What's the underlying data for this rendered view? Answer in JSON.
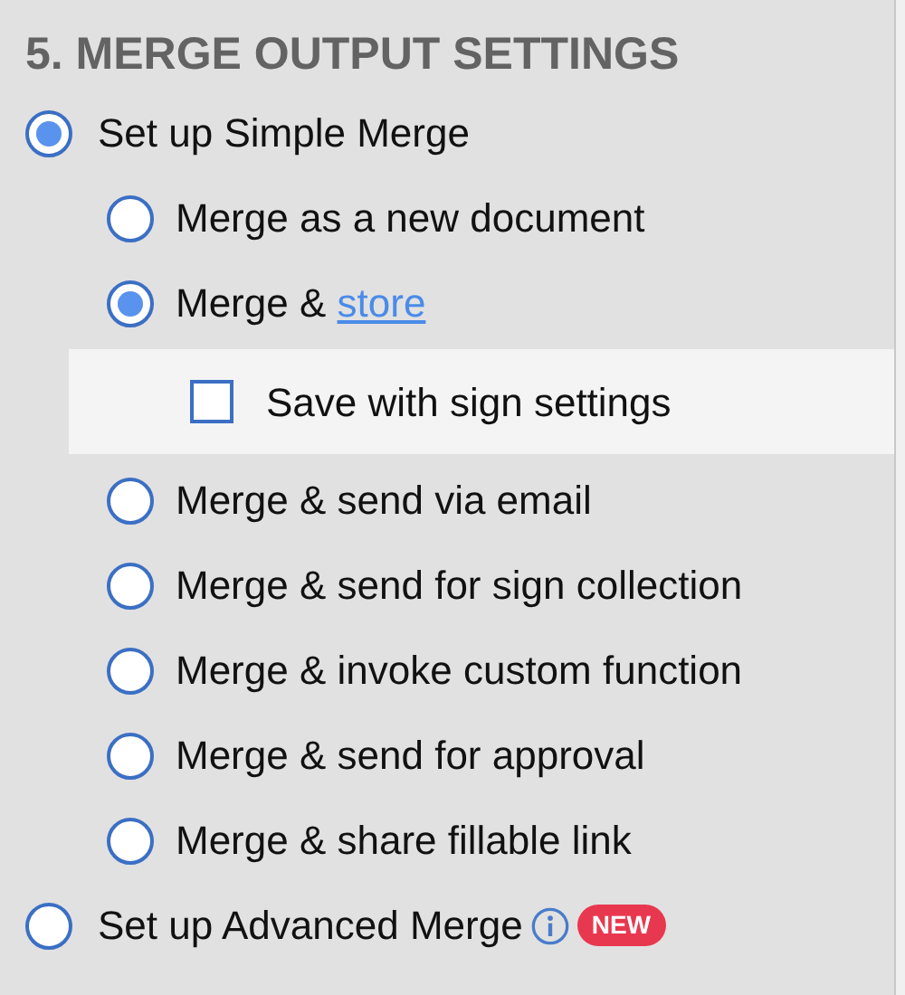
{
  "heading": "5. MERGE OUTPUT SETTINGS",
  "options": [
    {
      "label": "Set up Simple Merge",
      "selected": true,
      "children": [
        {
          "label": "Merge as a new document",
          "selected": false
        },
        {
          "label": "Merge &",
          "link": "store",
          "selected": true,
          "sub_options": [
            {
              "label": "Save with sign settings",
              "checked": false
            }
          ]
        },
        {
          "label": "Merge & send via email",
          "selected": false
        },
        {
          "label": "Merge & send for sign collection",
          "selected": false
        },
        {
          "label": "Merge & invoke custom function",
          "selected": false
        },
        {
          "label": "Merge & send for approval",
          "selected": false
        },
        {
          "label": "Merge & share fillable link",
          "selected": false
        }
      ]
    },
    {
      "label": "Set up Advanced Merge",
      "selected": false,
      "info": true,
      "badge": "NEW"
    }
  ]
}
